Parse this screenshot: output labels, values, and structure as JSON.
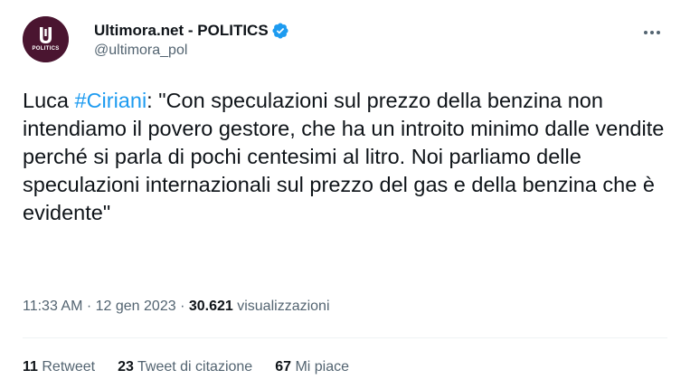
{
  "author": {
    "display_name": "Ultimora.net - POLITICS",
    "handle": "@ultimora_pol",
    "avatar_text": "POLITICS",
    "avatar_color": "#4a1530",
    "verified_icon": "verified-badge-icon",
    "verified_color": "#1d9bf0"
  },
  "tweet": {
    "text_prefix": "Luca ",
    "hashtag": "#Ciriani",
    "text_body": ": \"Con speculazioni sul prezzo della benzina non intendiamo il povero gestore, che ha un introito minimo dalle vendite perché si parla di pochi centesimi al litro. Noi parliamo delle speculazioni internazionali sul prezzo del gas e della benzina che è evidente\"",
    "hashtag_color": "#1d9bf0"
  },
  "meta": {
    "time": "11:33 AM",
    "separator": " · ",
    "date": "12 gen 2023",
    "views_count": "30.621",
    "views_label": " visualizzazioni"
  },
  "stats": {
    "retweets": {
      "count": "11",
      "label": " Retweet"
    },
    "quotes": {
      "count": "23",
      "label": " Tweet di citazione"
    },
    "likes": {
      "count": "67",
      "label": " Mi piace"
    }
  },
  "menu_icon": "more-horizontal-icon"
}
